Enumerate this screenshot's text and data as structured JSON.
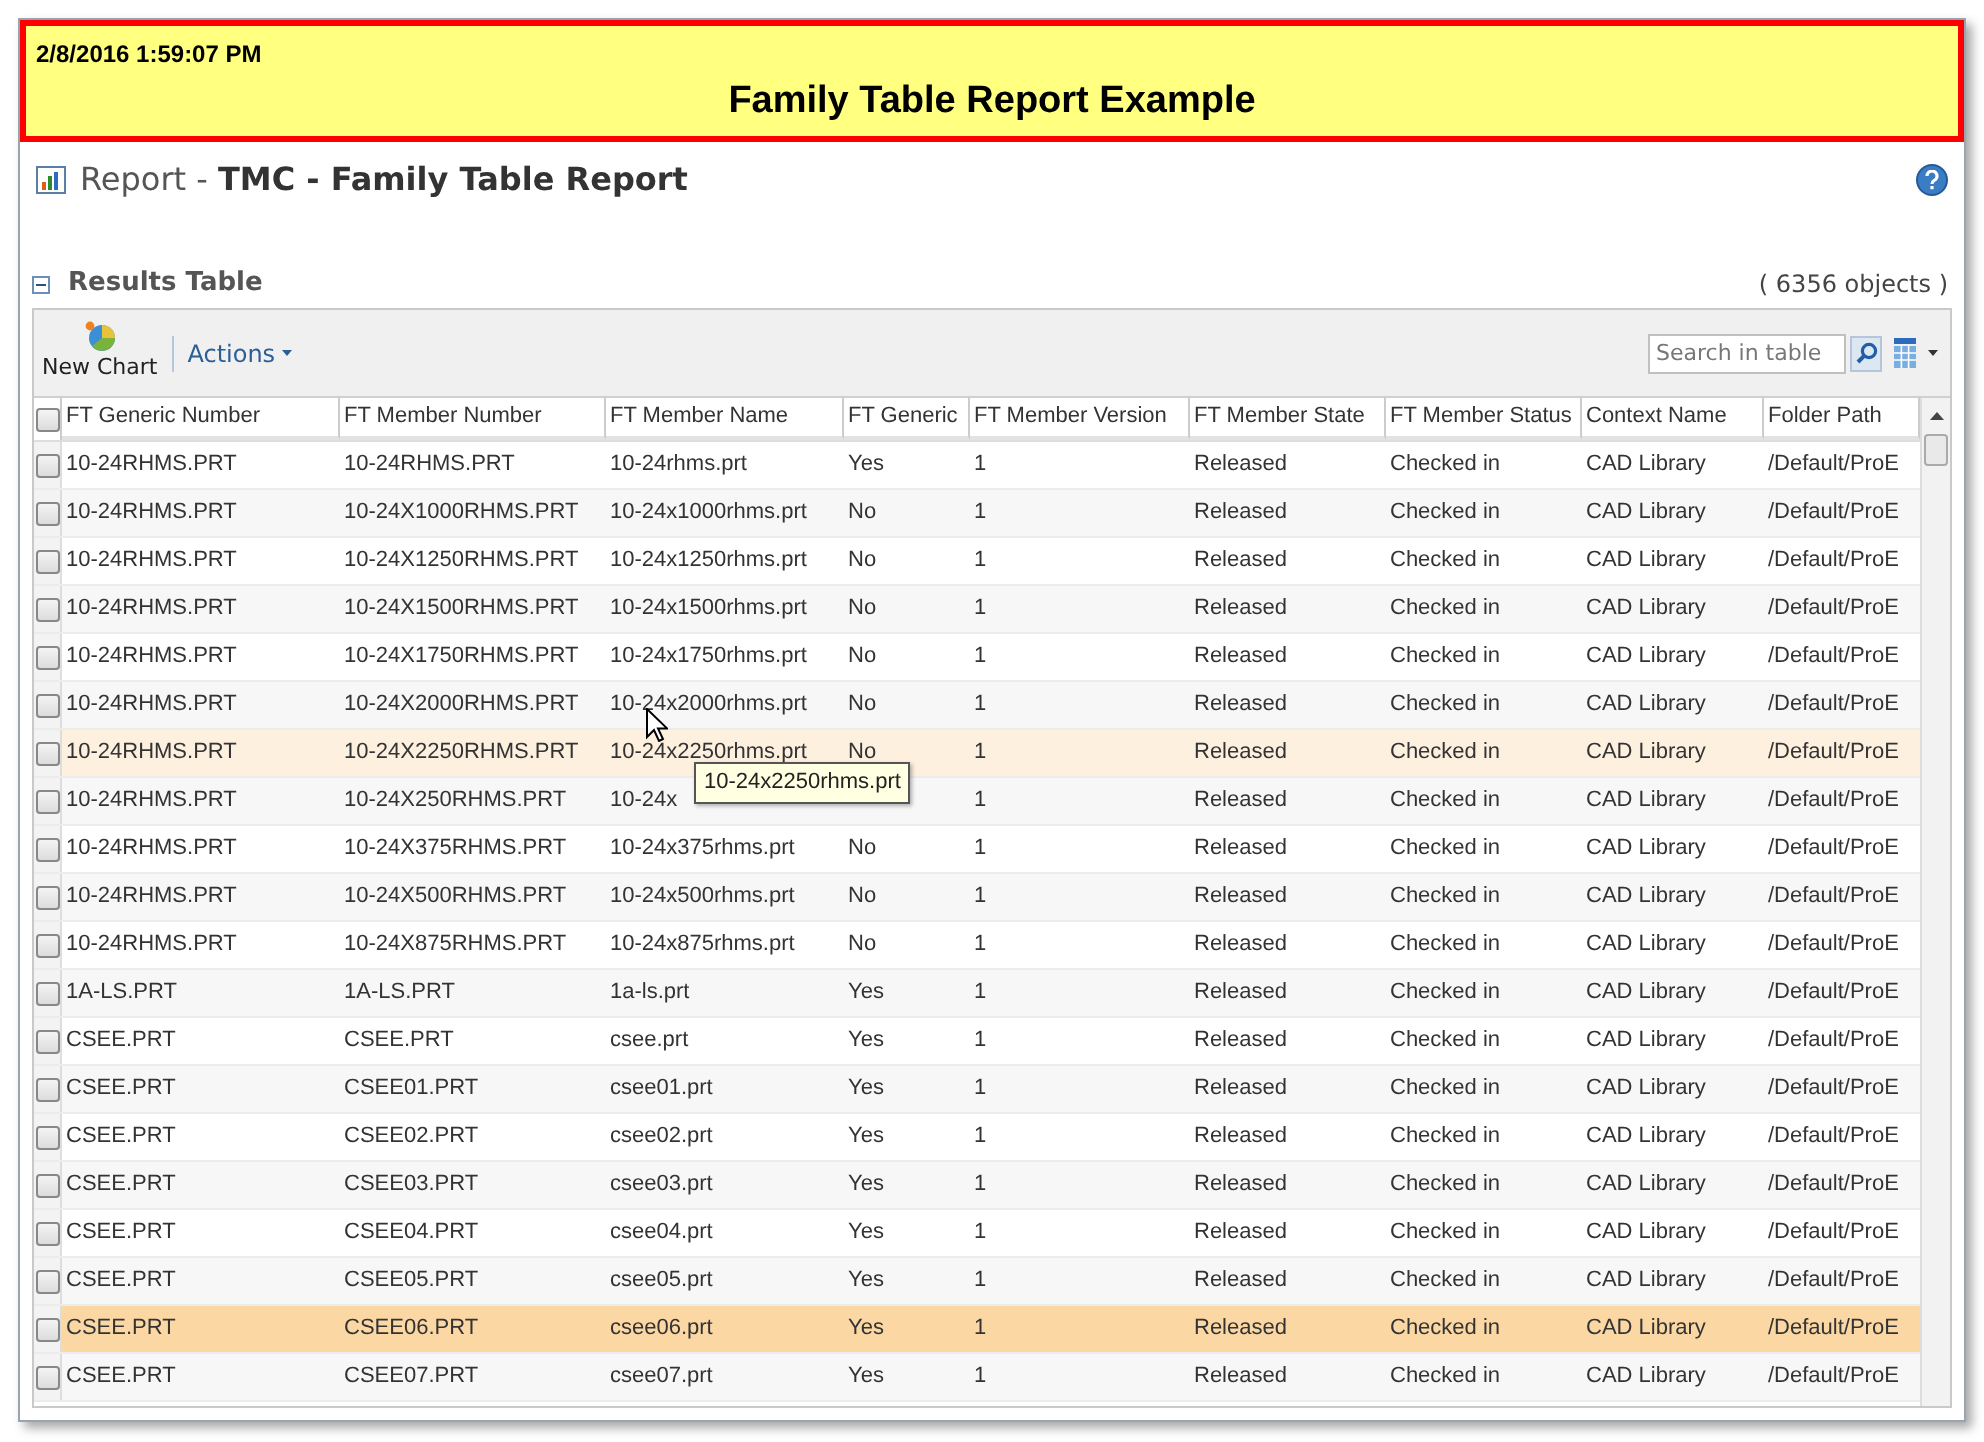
{
  "banner": {
    "timestamp": "2/8/2016 1:59:07 PM",
    "title": "Family Table Report Example"
  },
  "report": {
    "prefix": "Report - ",
    "name": "TMC - Family Table Report"
  },
  "section": {
    "title": "Results Table",
    "expanded": true,
    "count": "( 6356 objects )"
  },
  "toolbar": {
    "new_chart": "New Chart",
    "actions": "Actions",
    "search_placeholder": "Search in table"
  },
  "table": {
    "all_checked": false,
    "columns": [
      "FT Generic Number",
      "FT Member Number",
      "FT Member Name",
      "FT Generic",
      "FT Member Version",
      "FT Member State",
      "FT Member Status",
      "Context Name",
      "Folder Path"
    ],
    "rows": [
      {
        "cells": [
          "10-24RHMS.PRT",
          "10-24RHMS.PRT",
          "10-24rhms.prt",
          "Yes",
          "1",
          "Released",
          "Checked in",
          "CAD Library",
          "/Default/ProE"
        ],
        "checked": false,
        "hovered": false,
        "selected": false
      },
      {
        "cells": [
          "10-24RHMS.PRT",
          "10-24X1000RHMS.PRT",
          "10-24x1000rhms.prt",
          "No",
          "1",
          "Released",
          "Checked in",
          "CAD Library",
          "/Default/ProE"
        ],
        "checked": false,
        "hovered": false,
        "selected": false
      },
      {
        "cells": [
          "10-24RHMS.PRT",
          "10-24X1250RHMS.PRT",
          "10-24x1250rhms.prt",
          "No",
          "1",
          "Released",
          "Checked in",
          "CAD Library",
          "/Default/ProE"
        ],
        "checked": false,
        "hovered": false,
        "selected": false
      },
      {
        "cells": [
          "10-24RHMS.PRT",
          "10-24X1500RHMS.PRT",
          "10-24x1500rhms.prt",
          "No",
          "1",
          "Released",
          "Checked in",
          "CAD Library",
          "/Default/ProE"
        ],
        "checked": false,
        "hovered": false,
        "selected": false
      },
      {
        "cells": [
          "10-24RHMS.PRT",
          "10-24X1750RHMS.PRT",
          "10-24x1750rhms.prt",
          "No",
          "1",
          "Released",
          "Checked in",
          "CAD Library",
          "/Default/ProE"
        ],
        "checked": false,
        "hovered": false,
        "selected": false
      },
      {
        "cells": [
          "10-24RHMS.PRT",
          "10-24X2000RHMS.PRT",
          "10-24x2000rhms.prt",
          "No",
          "1",
          "Released",
          "Checked in",
          "CAD Library",
          "/Default/ProE"
        ],
        "checked": false,
        "hovered": false,
        "selected": false
      },
      {
        "cells": [
          "10-24RHMS.PRT",
          "10-24X2250RHMS.PRT",
          "10-24x2250rhms.prt",
          "No",
          "1",
          "Released",
          "Checked in",
          "CAD Library",
          "/Default/ProE"
        ],
        "checked": false,
        "hovered": true,
        "selected": false,
        "tooltip": "10-24x2250rhms.prt"
      },
      {
        "cells": [
          "10-24RHMS.PRT",
          "10-24X250RHMS.PRT",
          "10-24x",
          null,
          "1",
          "Released",
          "Checked in",
          "CAD Library",
          "/Default/ProE"
        ],
        "checked": false,
        "hovered": false,
        "selected": false
      },
      {
        "cells": [
          "10-24RHMS.PRT",
          "10-24X375RHMS.PRT",
          "10-24x375rhms.prt",
          "No",
          "1",
          "Released",
          "Checked in",
          "CAD Library",
          "/Default/ProE"
        ],
        "checked": false,
        "hovered": false,
        "selected": false
      },
      {
        "cells": [
          "10-24RHMS.PRT",
          "10-24X500RHMS.PRT",
          "10-24x500rhms.prt",
          "No",
          "1",
          "Released",
          "Checked in",
          "CAD Library",
          "/Default/ProE"
        ],
        "checked": false,
        "hovered": false,
        "selected": false
      },
      {
        "cells": [
          "10-24RHMS.PRT",
          "10-24X875RHMS.PRT",
          "10-24x875rhms.prt",
          "No",
          "1",
          "Released",
          "Checked in",
          "CAD Library",
          "/Default/ProE"
        ],
        "checked": false,
        "hovered": false,
        "selected": false
      },
      {
        "cells": [
          "1A-LS.PRT",
          "1A-LS.PRT",
          "1a-ls.prt",
          "Yes",
          "1",
          "Released",
          "Checked in",
          "CAD Library",
          "/Default/ProE"
        ],
        "checked": false,
        "hovered": false,
        "selected": false
      },
      {
        "cells": [
          "CSEE.PRT",
          "CSEE.PRT",
          "csee.prt",
          "Yes",
          "1",
          "Released",
          "Checked in",
          "CAD Library",
          "/Default/ProE"
        ],
        "checked": false,
        "hovered": false,
        "selected": false
      },
      {
        "cells": [
          "CSEE.PRT",
          "CSEE01.PRT",
          "csee01.prt",
          "Yes",
          "1",
          "Released",
          "Checked in",
          "CAD Library",
          "/Default/ProE"
        ],
        "checked": false,
        "hovered": false,
        "selected": false
      },
      {
        "cells": [
          "CSEE.PRT",
          "CSEE02.PRT",
          "csee02.prt",
          "Yes",
          "1",
          "Released",
          "Checked in",
          "CAD Library",
          "/Default/ProE"
        ],
        "checked": false,
        "hovered": false,
        "selected": false
      },
      {
        "cells": [
          "CSEE.PRT",
          "CSEE03.PRT",
          "csee03.prt",
          "Yes",
          "1",
          "Released",
          "Checked in",
          "CAD Library",
          "/Default/ProE"
        ],
        "checked": false,
        "hovered": false,
        "selected": false
      },
      {
        "cells": [
          "CSEE.PRT",
          "CSEE04.PRT",
          "csee04.prt",
          "Yes",
          "1",
          "Released",
          "Checked in",
          "CAD Library",
          "/Default/ProE"
        ],
        "checked": false,
        "hovered": false,
        "selected": false
      },
      {
        "cells": [
          "CSEE.PRT",
          "CSEE05.PRT",
          "csee05.prt",
          "Yes",
          "1",
          "Released",
          "Checked in",
          "CAD Library",
          "/Default/ProE"
        ],
        "checked": false,
        "hovered": false,
        "selected": false
      },
      {
        "cells": [
          "CSEE.PRT",
          "CSEE06.PRT",
          "csee06.prt",
          "Yes",
          "1",
          "Released",
          "Checked in",
          "CAD Library",
          "/Default/ProE"
        ],
        "checked": false,
        "hovered": false,
        "selected": true
      },
      {
        "cells": [
          "CSEE.PRT",
          "CSEE07.PRT",
          "csee07.prt",
          "Yes",
          "1",
          "Released",
          "Checked in",
          "CAD Library",
          "/Default/ProE"
        ],
        "checked": false,
        "hovered": false,
        "selected": false
      }
    ]
  }
}
